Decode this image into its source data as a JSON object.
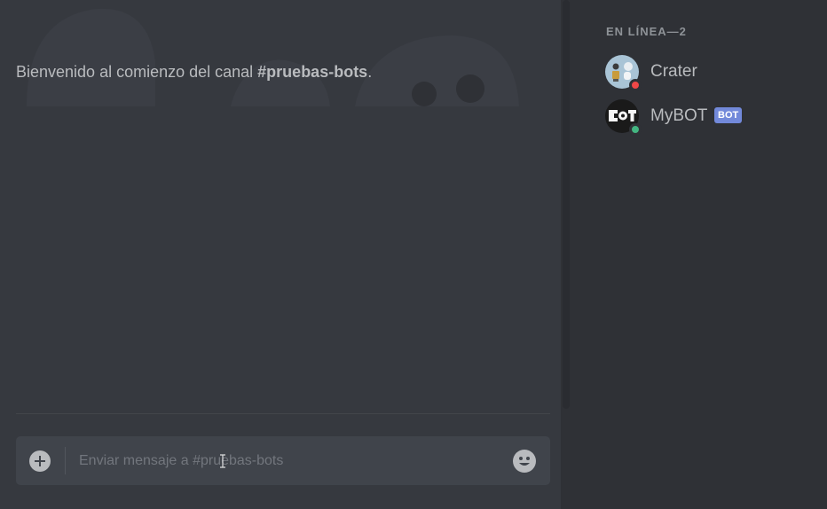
{
  "chat": {
    "welcome_prefix": "Bienvenido al comienzo del canal ",
    "channel_name": "#pruebas-bots",
    "welcome_suffix": "."
  },
  "composer": {
    "placeholder": "Enviar mensaje a #pruebas-bots",
    "value": "",
    "add_icon": "plus-circle-icon",
    "emoji_icon": "emoji-smile-icon"
  },
  "members": {
    "heading": "EN LÍNEA—2",
    "list": [
      {
        "name": "Crater",
        "status": "dnd",
        "status_color": "#f04747",
        "avatar": "robot-avatar",
        "bot": false
      },
      {
        "name": "MyBOT",
        "status": "online",
        "status_color": "#43b581",
        "avatar": "bot-logo-avatar",
        "bot": true,
        "badge": "BOT"
      }
    ]
  },
  "colors": {
    "chat_bg": "#36393f",
    "sidebar_bg": "#2f3136",
    "input_bg": "#40444b",
    "muted_text": "#b9bbbe",
    "blurple": "#7289da"
  }
}
